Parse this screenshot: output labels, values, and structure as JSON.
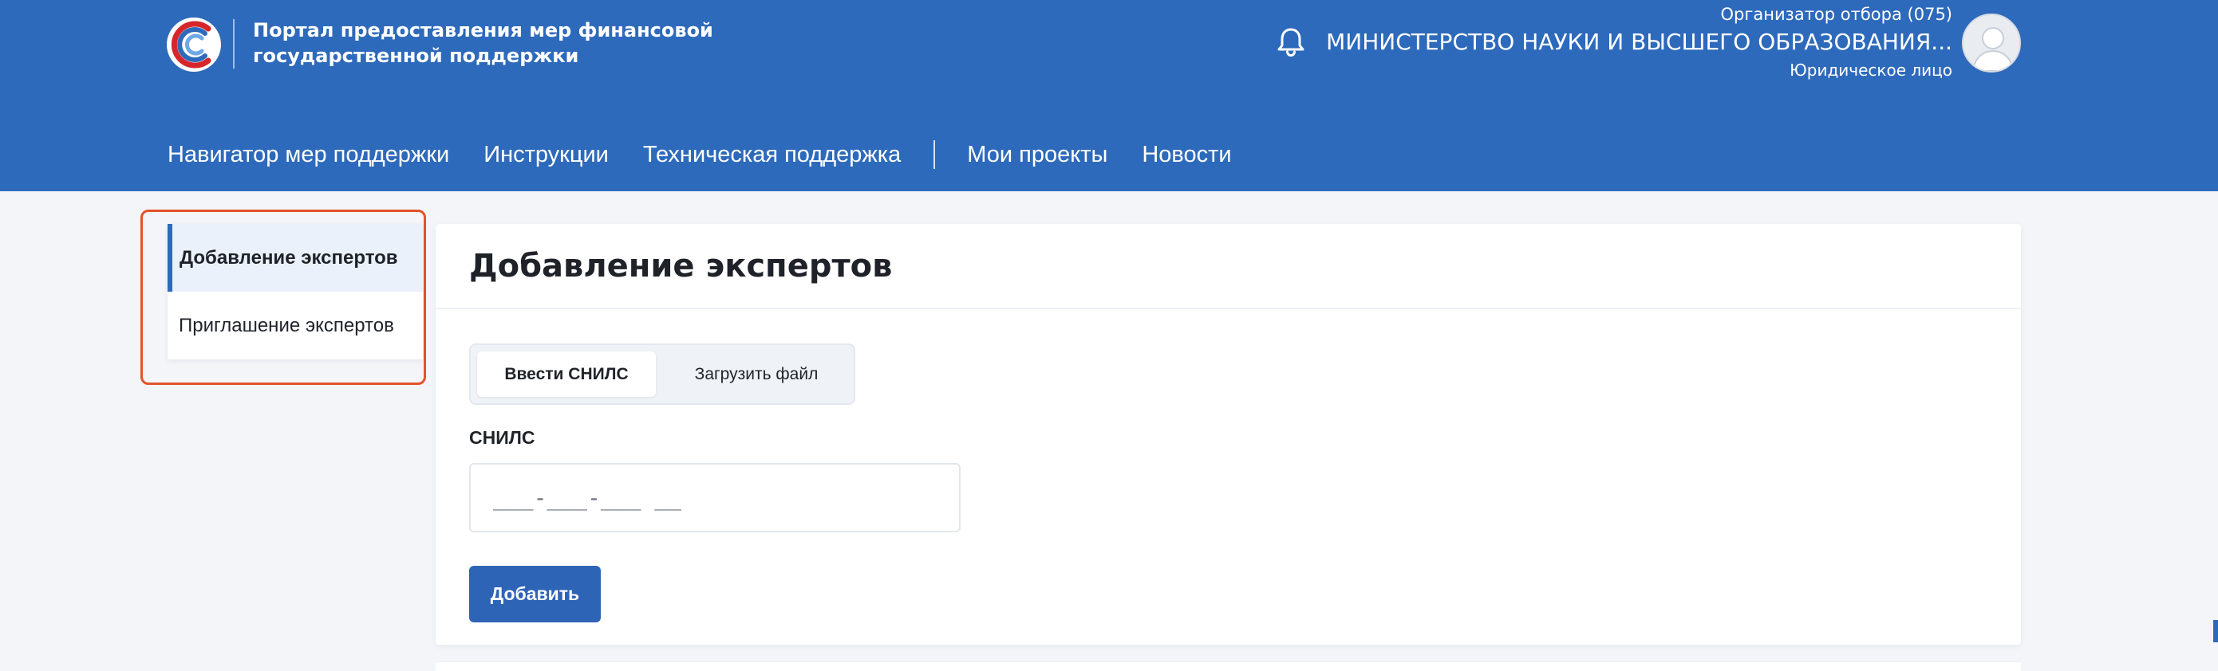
{
  "header": {
    "portal_title_line1": "Портал предоставления мер финансовой",
    "portal_title_line2": "государственной поддержки",
    "org_role": "Организатор отбора (075)",
    "org_name": "МИНИСТЕРСТВО НАУКИ И ВЫСШЕГО ОБРАЗОВАНИЯ...",
    "org_type": "Юридическое лицо",
    "icons": {
      "logo": "portal-logo",
      "notifications": "bell-icon",
      "avatar": "user-avatar"
    }
  },
  "nav": {
    "items": [
      {
        "label": "Навигатор мер поддержки"
      },
      {
        "label": "Инструкции"
      },
      {
        "label": "Техническая поддержка"
      },
      {
        "label": "Мои проекты"
      },
      {
        "label": "Новости"
      }
    ]
  },
  "sidebar": {
    "items": [
      {
        "label": "Добавление экспертов",
        "active": true
      },
      {
        "label": "Приглашение экспертов",
        "active": false
      }
    ]
  },
  "main": {
    "title": "Добавление экспертов",
    "tabs": [
      {
        "label": "Ввести СНИЛС",
        "active": true
      },
      {
        "label": "Загрузить файл",
        "active": false
      }
    ],
    "snils_label": "СНИЛС",
    "snils_placeholder": "___-___-___ __",
    "add_button": "Добавить"
  },
  "colors": {
    "header_bg": "#2e6abb",
    "accent": "#2e64b6",
    "highlight_border": "#e3532a",
    "page_bg": "#f3f5f8"
  }
}
